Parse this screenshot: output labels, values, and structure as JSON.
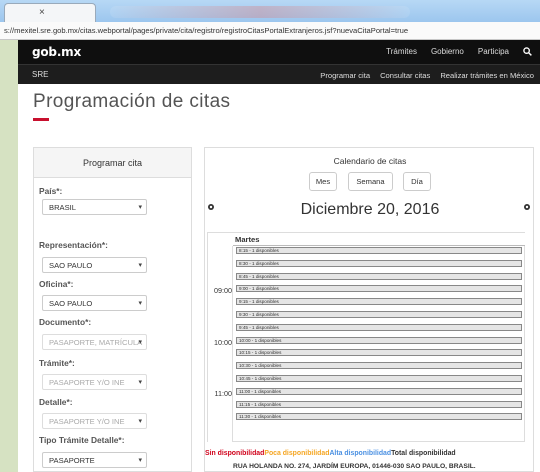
{
  "browser": {
    "tab_close": "×",
    "url": "s://mexitel.sre.gob.mx/citas.webportal/pages/private/cita/registro/registroCitasPortalExtranjeros.jsf?nuevaCitaPortal=true"
  },
  "gob_header": {
    "logo": "gob.mx",
    "nav": [
      "Trámites",
      "Gobierno",
      "Participa"
    ],
    "search_icon": "search-icon"
  },
  "sre_header": {
    "label": "SRE",
    "nav": [
      "Programar cita",
      "Consultar citas",
      "Realizar trámites en México"
    ]
  },
  "page": {
    "title": "Programación de citas"
  },
  "form": {
    "header": "Programar cita",
    "fields": [
      {
        "label": "País*:",
        "value": "BRASIL",
        "disabled": false
      },
      {
        "label": "Representación*:",
        "value": "SAO PAULO",
        "disabled": false
      },
      {
        "label": "Oficina*:",
        "value": "SAO PAULO",
        "disabled": false
      },
      {
        "label": "Documento*:",
        "value": "PASAPORTE, MATRÍCULA",
        "disabled": true
      },
      {
        "label": "Trámite*:",
        "value": "PASAPORTE Y/O INE",
        "disabled": true
      },
      {
        "label": "Detalle*:",
        "value": "PASAPORTE Y/O INE",
        "disabled": true
      },
      {
        "label": "Tipo Trámite Detalle*:",
        "value": "PASAPORTE",
        "disabled": false
      }
    ]
  },
  "calendar": {
    "title": "Calendario de citas",
    "views": [
      "Mes",
      "Semana",
      "Día"
    ],
    "date": "Diciembre 20, 2016",
    "prev_icon": "radio-prev-icon",
    "next_icon": "radio-next-icon",
    "day_label": "Martes",
    "hours": [
      "09:00",
      "10:00",
      "11:00"
    ],
    "slots": [
      "8:15 - 1 disponibles",
      "8:30 - 1 disponibles",
      "8:45 - 1 disponibles",
      "9:00 - 1 disponibles",
      "9:15 - 1 disponibles",
      "9:30 - 1 disponibles",
      "9:45 - 1 disponibles",
      "10:00 - 1 disponibles",
      "10:15 - 1 disponibles",
      "10:30 - 1 disponibles",
      "10:45 - 1 disponibles",
      "11:00 - 1 disponibles",
      "11:15 - 1 disponibles",
      "11:30 - 1 disponibles"
    ],
    "legend": [
      {
        "text": "Sin disponibilidad",
        "color": "#d0021b"
      },
      {
        "text": "Poca disponibilidad",
        "color": "#f5a623"
      },
      {
        "text": "Alta disponibilidad",
        "color": "#4a90e2"
      },
      {
        "text": "Total disponibilidad",
        "color": "#333333"
      }
    ],
    "address": "RUA HOLANDA NO. 274, JARDÍM EUROPA, 01446-030 SAO PAULO, BRASIL."
  },
  "colors": {
    "accent_red": "#c8102e",
    "header_black": "#0f0f0f"
  }
}
